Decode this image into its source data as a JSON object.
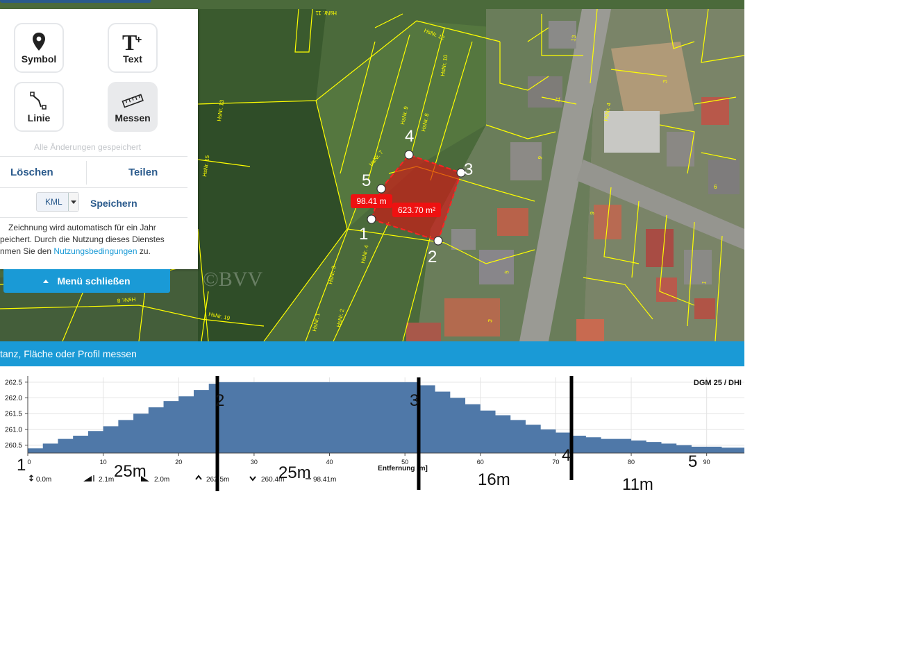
{
  "map": {
    "watermark": "©BVV",
    "parcel_labels": [
      "HsNr. 11",
      "HsNr. 12",
      "HsNr. 10",
      "HsNr. 9",
      "HsNr. 8",
      "HsNr. 7",
      "HsNr. 13",
      "HsNr. 15",
      "HsNr. 3",
      "HsNr. 4",
      "HsNr. 1",
      "HsNr. 2",
      "HsNr. 8",
      "HsNr. 19",
      "HsNr. 4"
    ],
    "house_numbers": [
      "13",
      "11",
      "9",
      "9",
      "6",
      "3",
      "5",
      "3",
      "1"
    ],
    "measurement": {
      "points": [
        "1",
        "2",
        "3",
        "4",
        "5"
      ],
      "distance_label": "98.41 m",
      "area_label": "623.70 m²"
    }
  },
  "panel": {
    "tools": [
      {
        "label": "Symbol",
        "icon": "map-marker-icon"
      },
      {
        "label": "Text",
        "icon": "text-plus-icon"
      },
      {
        "label": "Linie",
        "icon": "line-icon"
      },
      {
        "label": "Messen",
        "icon": "ruler-icon"
      }
    ],
    "saved_status": "Alle Änderungen gespeichert",
    "delete_label": "Löschen",
    "share_label": "Teilen",
    "format_select": "KML",
    "save_label": "Speichern",
    "disclaimer_line1": "Zeichnung wird automatisch für ein Jahr",
    "disclaimer_line2": "peichert. Durch die Nutzung dieses Dienstes",
    "disclaimer_line3_pre": "nmen Sie den",
    "terms_link": "Nutzungsbedingungen",
    "disclaimer_line3_post": "zu.",
    "close_menu_label": "Menü schließen"
  },
  "measure_bar": {
    "title": "tanz, Fläche oder Profil messen"
  },
  "profile_stats": {
    "height_diff": "0.0m",
    "ascent": "2.1m",
    "descent": "2.0m",
    "max": "262.5m",
    "min": "260.4m",
    "length": "98.41m"
  },
  "annotations": {
    "points": [
      "1",
      "2",
      "3",
      "4",
      "5"
    ],
    "segments": [
      "25m",
      "25m",
      "16m",
      "11m"
    ]
  },
  "chart_data": {
    "type": "area",
    "title": "DGM 25 / DHI",
    "xlabel": "Entfernung [m]",
    "ylabel": "",
    "xlim": [
      0,
      95
    ],
    "ylim": [
      260.25,
      262.65
    ],
    "x_ticks": [
      0,
      10,
      20,
      30,
      40,
      50,
      60,
      70,
      80,
      90
    ],
    "y_ticks": [
      260.5,
      261.0,
      261.5,
      262.0,
      262.5
    ],
    "y_tick_labels": [
      "260.5",
      "261.0",
      "261.5",
      "262.0",
      "262.5"
    ],
    "grid": true,
    "series": [
      {
        "x": [
          0,
          2,
          4,
          6,
          8,
          10,
          12,
          14,
          16,
          18,
          20,
          22,
          24,
          25,
          30,
          35,
          40,
          45,
          50,
          52,
          54,
          56,
          58,
          60,
          62,
          64,
          66,
          68,
          70,
          72,
          74,
          76,
          78,
          80,
          82,
          84,
          86,
          88,
          90,
          92,
          95
        ],
        "y": [
          260.4,
          260.55,
          260.7,
          260.8,
          260.95,
          261.1,
          261.3,
          261.5,
          261.7,
          261.9,
          262.05,
          262.25,
          262.45,
          262.5,
          262.5,
          262.5,
          262.5,
          262.5,
          262.5,
          262.4,
          262.2,
          262.0,
          261.8,
          261.6,
          261.45,
          261.3,
          261.15,
          261.0,
          260.9,
          260.8,
          260.75,
          260.7,
          260.7,
          260.65,
          260.6,
          260.55,
          260.5,
          260.45,
          260.45,
          260.42,
          260.4
        ]
      }
    ]
  }
}
